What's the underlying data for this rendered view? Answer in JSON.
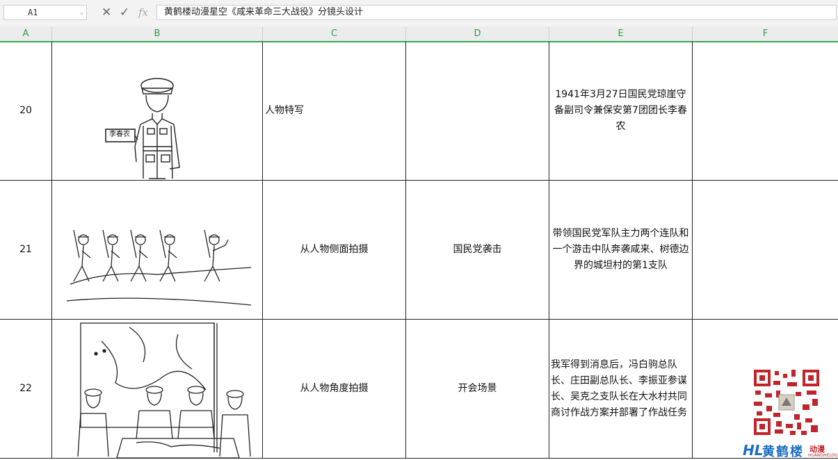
{
  "formula_bar": {
    "cell_ref": "A1",
    "cancel_icon": "close-icon",
    "confirm_icon": "check-icon",
    "fx_label": "fx",
    "content": "黄鹤楼动漫星空《咸来革命三大战役》分镜头设计"
  },
  "columns": [
    "A",
    "B",
    "C",
    "D",
    "E",
    "F"
  ],
  "rows": [
    {
      "number": "20",
      "shot": "人物特写",
      "scene": "",
      "description": "1941年3月27日国民党琼崖守备副司令兼保安第7团团长李春农",
      "sketch": "officer-portrait-sketch",
      "sign": "李春农"
    },
    {
      "number": "21",
      "shot": "从人物侧面拍摄",
      "scene": "国民党袭击",
      "description": "带领国民党军队主力两个连队和一个游击中队奔袭咸来、树德边界的城坦村的第1支队",
      "sketch": "marching-soldiers-sketch"
    },
    {
      "number": "22",
      "shot": "从人物角度拍摄",
      "scene": "开会场景",
      "description": "我军得到消息后，冯白驹总队长、庄田副总队长、李振亚参谋长、吴克之支队长在大水村共同商讨作战方案并部署了作战任务",
      "sketch": "meeting-map-sketch"
    }
  ],
  "watermark": {
    "logo_text": "黄鹤楼",
    "logo_suffix": "动漫",
    "logo_sub": "HUANGHELOU"
  }
}
